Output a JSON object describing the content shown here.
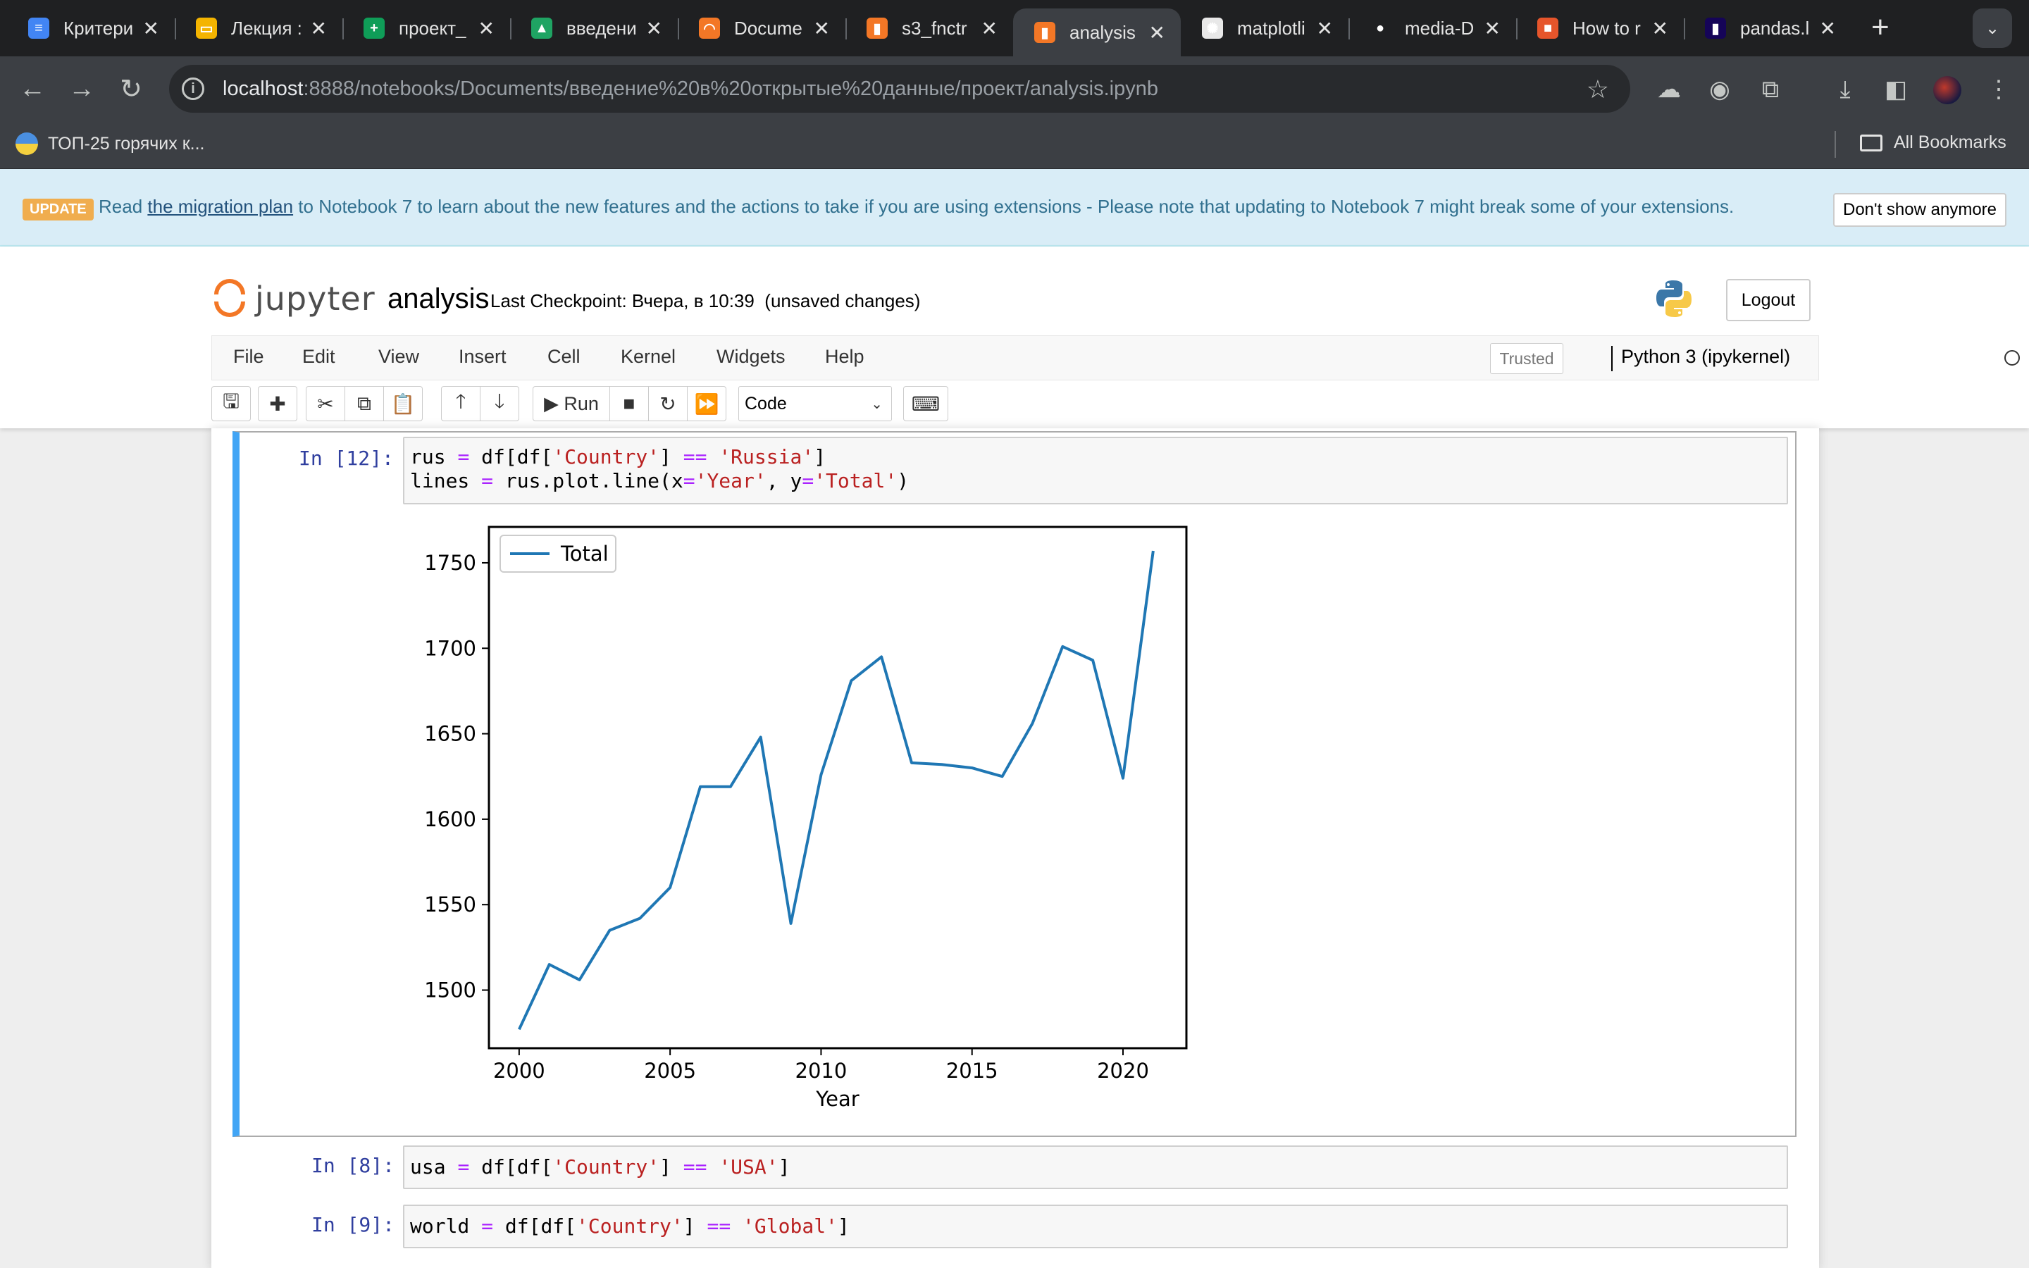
{
  "browser": {
    "tabs": [
      {
        "title": "Критери",
        "favicon_color": "#4285f4",
        "favicon_glyph": "≡"
      },
      {
        "title": "Лекция :",
        "favicon_color": "#f4b400",
        "favicon_glyph": "▭"
      },
      {
        "title": "проект_",
        "favicon_color": "#0f9d58",
        "favicon_glyph": "+"
      },
      {
        "title": "введени",
        "favicon_color": "#1fa463",
        "favicon_glyph": "▲"
      },
      {
        "title": "Docume",
        "favicon_color": "#f37726",
        "favicon_glyph": "◠"
      },
      {
        "title": "s3_fnctr",
        "favicon_color": "#f37726",
        "favicon_glyph": "▮"
      },
      {
        "title": "analysis",
        "favicon_color": "#f37726",
        "favicon_glyph": "▮"
      },
      {
        "title": "matplotli",
        "favicon_color": "#e8e8e8",
        "favicon_glyph": "✺"
      },
      {
        "title": "media-D",
        "favicon_color": "#1f2022",
        "favicon_glyph": "●"
      },
      {
        "title": "How to r",
        "favicon_color": "#e6552b",
        "favicon_glyph": "■"
      },
      {
        "title": "pandas.l",
        "favicon_color": "#150458",
        "favicon_glyph": "▮"
      }
    ],
    "active_tab_index": 6,
    "url_host": "localhost",
    "url_rest": ":8888/notebooks/Documents/введение%20в%20открытые%20данные/проект/analysis.ipynb",
    "bookmark": "ТОП-25 горячих к...",
    "all_bookmarks": "All Bookmarks"
  },
  "banner": {
    "badge": "UPDATE",
    "text_before": "Read ",
    "link": "the migration plan",
    "text_after": " to Notebook 7 to learn about the new features and the actions to take if you are using extensions - Please note that updating to Notebook 7 might break some of your extensions.",
    "dismiss": "Don't show anymore"
  },
  "jupyter": {
    "logo_text": "jupyter",
    "notebook_name": "analysis",
    "checkpoint": "Last Checkpoint: Вчера, в 10:39",
    "unsaved": "(unsaved changes)",
    "logout": "Logout",
    "menu": [
      "File",
      "Edit",
      "View",
      "Insert",
      "Cell",
      "Kernel",
      "Widgets",
      "Help"
    ],
    "trusted": "Trusted",
    "kernel": "Python 3 (ipykernel)",
    "run_label": "Run",
    "cell_type": "Code"
  },
  "cells": [
    {
      "prompt": "In [12]:",
      "lines": [
        [
          [
            "v",
            "rus "
          ],
          [
            "o",
            "="
          ],
          [
            "v",
            " df[df["
          ],
          [
            "s",
            "'Country'"
          ],
          [
            "v",
            "] "
          ],
          [
            "o",
            "=="
          ],
          [
            "v",
            " "
          ],
          [
            "s",
            "'Russia'"
          ],
          [
            "v",
            "]"
          ]
        ],
        [
          [
            "v",
            "lines "
          ],
          [
            "o",
            "="
          ],
          [
            "v",
            " rus.plot.line(x"
          ],
          [
            "o",
            "="
          ],
          [
            "s",
            "'Year'"
          ],
          [
            "v",
            ", y"
          ],
          [
            "o",
            "="
          ],
          [
            "s",
            "'Total'"
          ],
          [
            "v",
            ")"
          ]
        ]
      ]
    },
    {
      "prompt": "In [8]:",
      "lines": [
        [
          [
            "v",
            "usa "
          ],
          [
            "o",
            "="
          ],
          [
            "v",
            " df[df["
          ],
          [
            "s",
            "'Country'"
          ],
          [
            "v",
            "] "
          ],
          [
            "o",
            "=="
          ],
          [
            "v",
            " "
          ],
          [
            "s",
            "'USA'"
          ],
          [
            "v",
            "]"
          ]
        ]
      ]
    },
    {
      "prompt": "In [9]:",
      "lines": [
        [
          [
            "v",
            "world "
          ],
          [
            "o",
            "="
          ],
          [
            "v",
            " df[df["
          ],
          [
            "s",
            "'Global'"
          ],
          [
            "v",
            "]"
          ]
        ]
      ]
    }
  ],
  "chart_data": {
    "type": "line",
    "xlabel": "Year",
    "ylabel": "",
    "xlim": [
      1999,
      2022.1
    ],
    "ylim": [
      1466,
      1771
    ],
    "xticks": [
      2000,
      2005,
      2010,
      2015,
      2020
    ],
    "yticks": [
      1500,
      1550,
      1600,
      1650,
      1700,
      1750
    ],
    "legend_position": "top-left",
    "series": [
      {
        "name": "Total",
        "color": "#1f77b4",
        "x": [
          2000,
          2001,
          2002,
          2003,
          2004,
          2005,
          2006,
          2007,
          2008,
          2009,
          2010,
          2011,
          2012,
          2013,
          2014,
          2015,
          2016,
          2017,
          2018,
          2019,
          2020,
          2021
        ],
        "values": [
          1477,
          1515,
          1506,
          1535,
          1542,
          1560,
          1619,
          1619,
          1648,
          1539,
          1626,
          1681,
          1695,
          1633,
          1632,
          1630,
          1625,
          1656,
          1701,
          1693,
          1624,
          1757
        ]
      }
    ]
  }
}
